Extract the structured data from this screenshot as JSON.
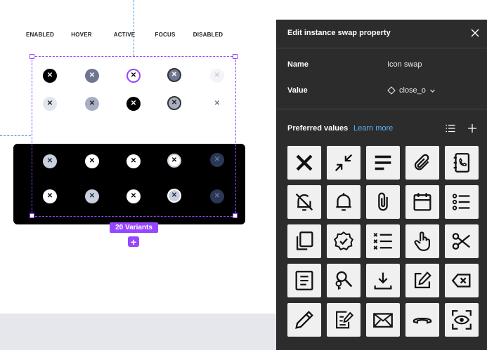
{
  "canvas": {
    "column_labels": [
      "ENABLED",
      "HOVER",
      "ACTIVE",
      "FOCUS",
      "DISABLED"
    ],
    "variants_label": "20 Variants",
    "add_symbol": "+"
  },
  "panel": {
    "title": "Edit instance swap property",
    "name_label": "Name",
    "name_value": "Icon swap",
    "value_label": "Value",
    "value_value": "close_o",
    "preferred_label": "Preferred values",
    "learn_more": "Learn more",
    "icons": [
      "close-x-icon",
      "collapse-arrows-icon",
      "text-align-left-icon",
      "paperclip-icon",
      "contacts-book-icon",
      "bell-off-icon",
      "bell-icon",
      "attachment-icon",
      "calendar-icon",
      "bullet-list-icon",
      "copy-icon",
      "verified-badge-icon",
      "checklist-icon",
      "hand-pointer-icon",
      "scissors-icon",
      "document-icon",
      "keys-search-icon",
      "download-icon",
      "edit-square-icon",
      "backspace-icon",
      "pencil-icon",
      "form-edit-icon",
      "mail-icon",
      "phone-hangup-icon",
      "scan-eye-icon"
    ]
  },
  "colors": {
    "accent": "#9747ff",
    "panel_bg": "#2c2c2c",
    "link": "#5fb1f7"
  }
}
